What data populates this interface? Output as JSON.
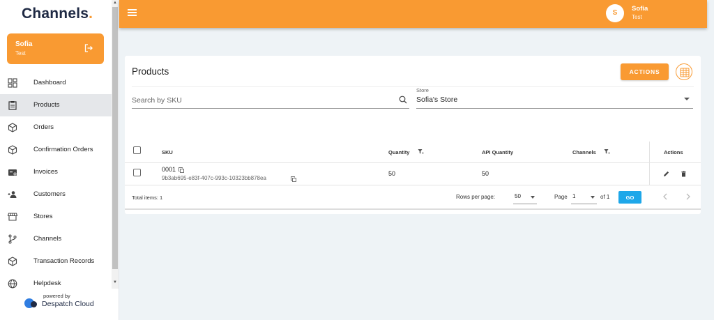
{
  "sidebar": {
    "brand": "Channels",
    "brand_dot": ".",
    "user": {
      "name": "Sofia",
      "sub": "Test"
    },
    "items": [
      {
        "label": "Dashboard",
        "icon": "dashboard-icon",
        "active": false
      },
      {
        "label": "Products",
        "icon": "clipboard-icon",
        "active": true
      },
      {
        "label": "Orders",
        "icon": "box-icon",
        "active": false
      },
      {
        "label": "Confirmation Orders",
        "icon": "box-icon",
        "active": false
      },
      {
        "label": "Invoices",
        "icon": "invoice-icon",
        "active": false
      },
      {
        "label": "Customers",
        "icon": "add-user-icon",
        "active": false
      },
      {
        "label": "Stores",
        "icon": "store-icon",
        "active": false
      },
      {
        "label": "Channels",
        "icon": "fork-icon",
        "active": false
      },
      {
        "label": "Transaction Records",
        "icon": "box-icon",
        "active": false
      },
      {
        "label": "Helpdesk",
        "icon": "globe-icon",
        "active": false
      }
    ],
    "powered_by": "powered by",
    "powered_name": "Despatch Cloud"
  },
  "header": {
    "avatar_initial": "S",
    "user_name": "Sofia",
    "user_sub": "Test"
  },
  "products": {
    "title": "Products",
    "actions_label": "ACTIONS",
    "search_placeholder": "Search by SKU",
    "store_label": "Store",
    "store_value": "Sofia's Store",
    "columns": {
      "sku": "SKU",
      "quantity": "Quantity",
      "api_quantity": "API Quantity",
      "channels": "Channels",
      "actions": "Actions"
    },
    "rows": [
      {
        "sku": "0001",
        "sku_id": "9b3ab695-e83f-407c-993c-10323bb878ea",
        "quantity": "50",
        "api_quantity": "50",
        "channels": ""
      }
    ],
    "footer": {
      "total": "Total items: 1",
      "rows_per_page_label": "Rows per page:",
      "rows_per_page": "50",
      "page_label": "Page",
      "page": "1",
      "of": "of 1",
      "go": "GO"
    }
  },
  "colors": {
    "accent": "#f99a32",
    "go": "#1ea7e9",
    "brand_text": "#1f2a44"
  }
}
